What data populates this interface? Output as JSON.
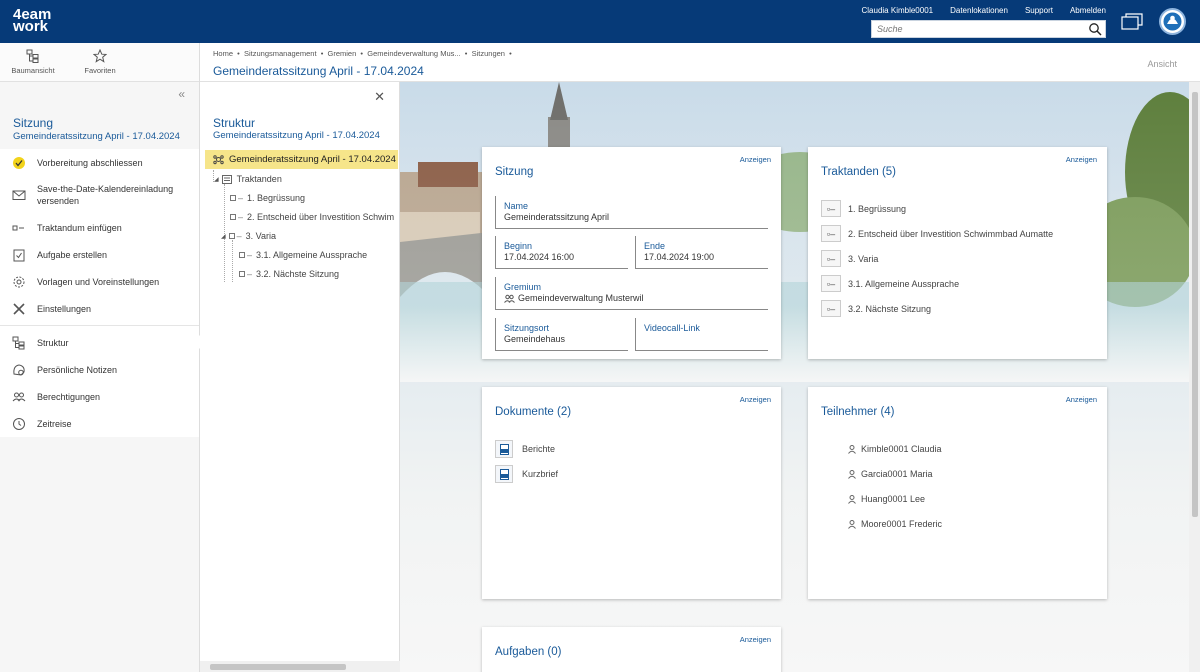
{
  "app": {
    "logo_line1": "4eam",
    "logo_line2": "work"
  },
  "topbar": {
    "user": "Claudia Kimble0001",
    "links": [
      "Datenlokationen",
      "Support",
      "Abmelden"
    ],
    "search_placeholder": "Suche"
  },
  "rail": {
    "buttons": [
      {
        "label": "Baumansicht",
        "icon": "tree-icon"
      },
      {
        "label": "Favoriten",
        "icon": "star-icon"
      }
    ],
    "context_type": "Sitzung",
    "context_title": "Gemeinderatssitzung April - 17.04.2024",
    "actions": [
      {
        "label": "Vorbereitung abschliessen",
        "icon": "check-circle-icon"
      },
      {
        "label": "Save-the-Date-Kalendereinladung versenden",
        "icon": "mail-icon"
      },
      {
        "label": "Traktandum einfügen",
        "icon": "agenda-item-icon"
      },
      {
        "label": "Aufgabe erstellen",
        "icon": "task-icon"
      },
      {
        "label": "Vorlagen und Voreinstellungen",
        "icon": "gear-icon"
      },
      {
        "label": "Einstellungen",
        "icon": "tools-icon"
      },
      {
        "label": "Struktur",
        "icon": "structure-icon"
      },
      {
        "label": "Persönliche Notizen",
        "icon": "notes-icon"
      },
      {
        "label": "Berechtigungen",
        "icon": "users-icon"
      },
      {
        "label": "Zeitreise",
        "icon": "history-icon"
      }
    ]
  },
  "structure": {
    "title": "Struktur",
    "subtitle": "Gemeinderatssitzung April - 17.04.2024",
    "root": "Gemeinderatssitzung April - 17.04.2024",
    "nodes": [
      "Traktanden",
      "1. Begrüssung",
      "2. Entscheid über Investition Schwim",
      "3. Varia",
      "3.1. Allgemeine Aussprache",
      "3.2. Nächste Sitzung"
    ]
  },
  "header": {
    "breadcrumb": [
      "Home",
      "Sitzungsmanagement",
      "Gremien",
      "Gemeindeverwaltung Mus...",
      "Sitzungen"
    ],
    "title": "Gemeinderatssitzung April - 17.04.2024",
    "view_label": "Ansicht"
  },
  "cards": {
    "show_label": "Anzeigen",
    "sitzung": {
      "title": "Sitzung",
      "name_label": "Name",
      "name_value": "Gemeinderatssitzung April",
      "begin_label": "Beginn",
      "begin_value": "17.04.2024 16:00",
      "end_label": "Ende",
      "end_value": "17.04.2024 19:00",
      "gremium_label": "Gremium",
      "gremium_value": "Gemeindeverwaltung Musterwil",
      "ort_label": "Sitzungsort",
      "ort_value": "Gemeindehaus",
      "video_label": "Videocall-Link"
    },
    "traktanden": {
      "title": "Traktanden (5)",
      "items": [
        "1. Begrüssung",
        "2. Entscheid über Investition Schwimmbad Aumatte",
        "3. Varia",
        "3.1. Allgemeine Aussprache",
        "3.2. Nächste Sitzung"
      ]
    },
    "dokumente": {
      "title": "Dokumente (2)",
      "items": [
        "Berichte",
        "Kurzbrief"
      ]
    },
    "teilnehmer": {
      "title": "Teilnehmer (4)",
      "items": [
        "Kimble0001 Claudia",
        "Garcia0001 Maria",
        "Huang0001 Lee",
        "Moore0001 Frederic"
      ]
    },
    "aufgaben": {
      "title": "Aufgaben (0)"
    }
  },
  "colors": {
    "brand": "#063a78",
    "accent": "#1a5a99",
    "highlight": "#f6e58a"
  }
}
